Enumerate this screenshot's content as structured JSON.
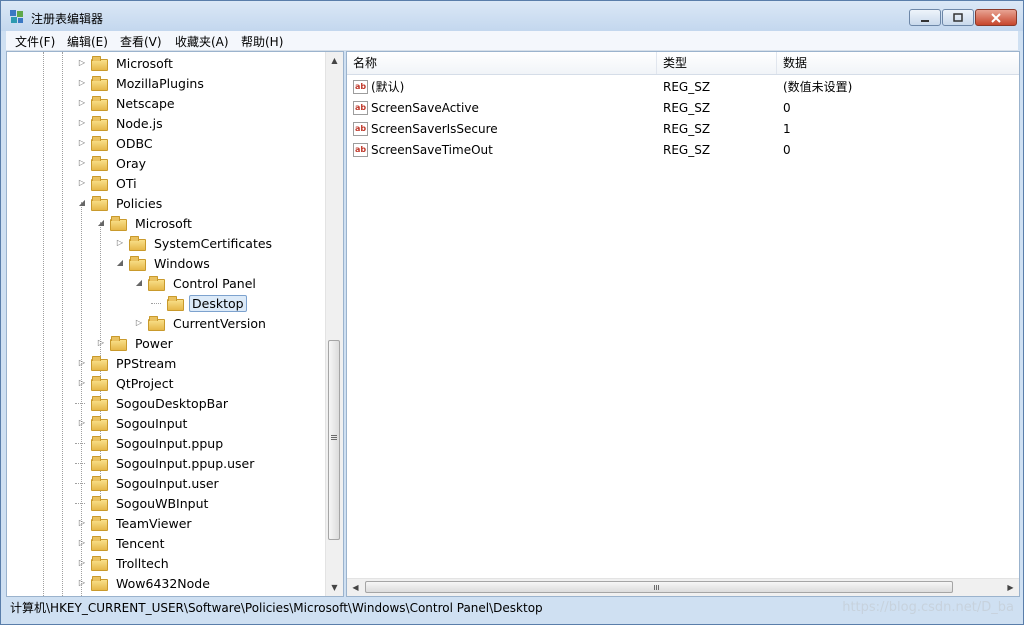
{
  "window": {
    "title": "注册表编辑器"
  },
  "menu": [
    "文件(F)",
    "编辑(E)",
    "查看(V)",
    "收藏夹(A)",
    "帮助(H)"
  ],
  "tree": [
    {
      "label": "Microsoft",
      "level": 0,
      "exp": "closed"
    },
    {
      "label": "MozillaPlugins",
      "level": 0,
      "exp": "closed"
    },
    {
      "label": "Netscape",
      "level": 0,
      "exp": "closed"
    },
    {
      "label": "Node.js",
      "level": 0,
      "exp": "closed"
    },
    {
      "label": "ODBC",
      "level": 0,
      "exp": "closed"
    },
    {
      "label": "Oray",
      "level": 0,
      "exp": "closed"
    },
    {
      "label": "OTi",
      "level": 0,
      "exp": "closed"
    },
    {
      "label": "Policies",
      "level": 0,
      "exp": "open"
    },
    {
      "label": "Microsoft",
      "level": 1,
      "exp": "open"
    },
    {
      "label": "SystemCertificates",
      "level": 2,
      "exp": "closed"
    },
    {
      "label": "Windows",
      "level": 2,
      "exp": "open"
    },
    {
      "label": "Control Panel",
      "level": 3,
      "exp": "open"
    },
    {
      "label": "Desktop",
      "level": 4,
      "exp": "none",
      "selected": true
    },
    {
      "label": "CurrentVersion",
      "level": 3,
      "exp": "closed"
    },
    {
      "label": "Power",
      "level": 1,
      "exp": "closed"
    },
    {
      "label": "PPStream",
      "level": 0,
      "exp": "closed"
    },
    {
      "label": "QtProject",
      "level": 0,
      "exp": "closed"
    },
    {
      "label": "SogouDesktopBar",
      "level": 0,
      "exp": "none"
    },
    {
      "label": "SogouInput",
      "level": 0,
      "exp": "closed"
    },
    {
      "label": "SogouInput.ppup",
      "level": 0,
      "exp": "none"
    },
    {
      "label": "SogouInput.ppup.user",
      "level": 0,
      "exp": "none"
    },
    {
      "label": "SogouInput.user",
      "level": 0,
      "exp": "none"
    },
    {
      "label": "SogouWBInput",
      "level": 0,
      "exp": "none"
    },
    {
      "label": "TeamViewer",
      "level": 0,
      "exp": "closed"
    },
    {
      "label": "Tencent",
      "level": 0,
      "exp": "closed"
    },
    {
      "label": "Trolltech",
      "level": 0,
      "exp": "closed"
    },
    {
      "label": "Wow6432Node",
      "level": 0,
      "exp": "closed"
    }
  ],
  "columns": [
    "名称",
    "类型",
    "数据"
  ],
  "values": [
    {
      "name": "(默认)",
      "type": "REG_SZ",
      "data": "(数值未设置)"
    },
    {
      "name": "ScreenSaveActive",
      "type": "REG_SZ",
      "data": "0"
    },
    {
      "name": "ScreenSaverIsSecure",
      "type": "REG_SZ",
      "data": "1"
    },
    {
      "name": "ScreenSaveTimeOut",
      "type": "REG_SZ",
      "data": "0"
    }
  ],
  "status_path": "计算机\\HKEY_CURRENT_USER\\Software\\Policies\\Microsoft\\Windows\\Control Panel\\Desktop",
  "watermark": "https://blog.csdn.net/D_ba",
  "icons": {
    "app": "registry-editor-icon",
    "string_value": "ab-string-icon",
    "folder": "folder-icon"
  }
}
